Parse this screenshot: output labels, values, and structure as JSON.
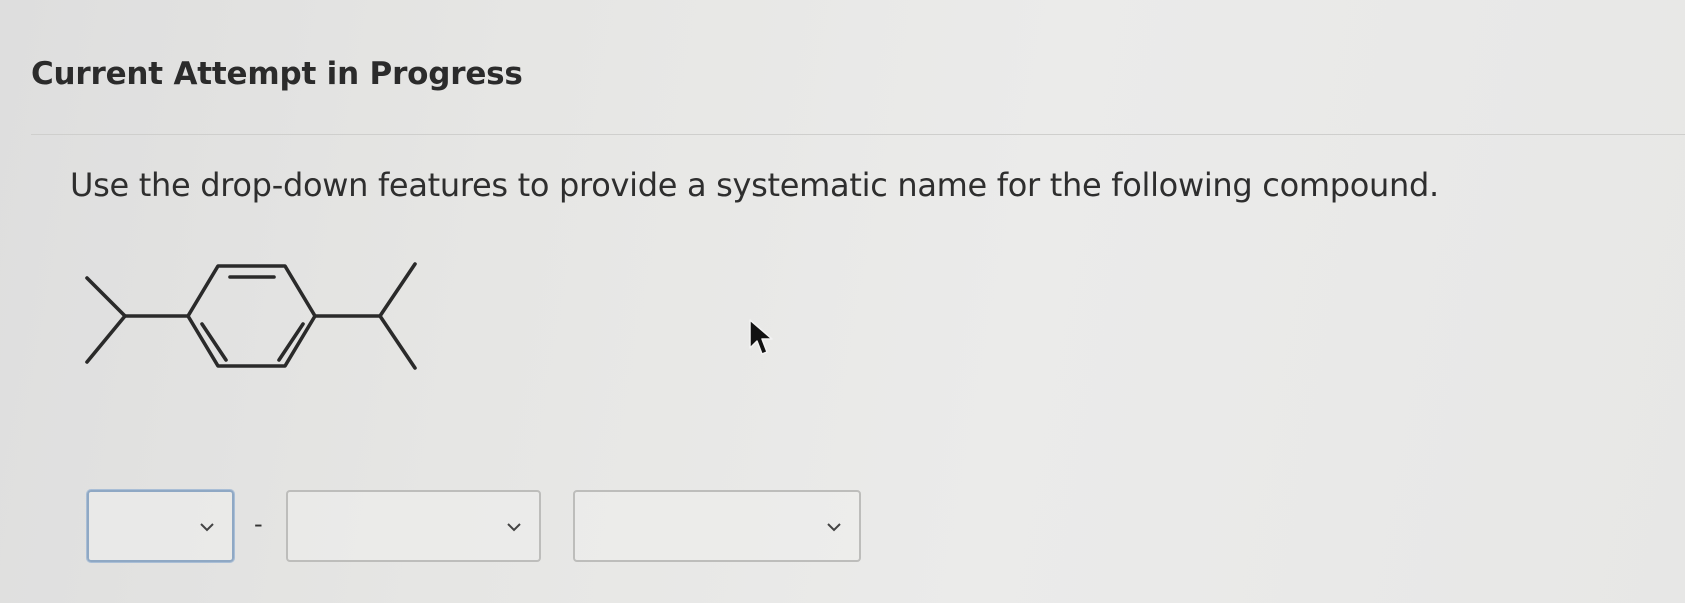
{
  "header": {
    "title": "Current Attempt in Progress"
  },
  "question": {
    "prompt": "Use the drop-down features to provide a systematic name for the following compound."
  },
  "answer": {
    "separator": "-",
    "dropdowns": [
      {
        "id": "locants",
        "value": ""
      },
      {
        "id": "substituent",
        "value": ""
      },
      {
        "id": "parent",
        "value": ""
      }
    ]
  },
  "icons": {
    "dropdown_chevron": "chevron-down-icon",
    "pointer": "mouse-cursor-icon"
  },
  "colors": {
    "focus_border": "#8fa8c4",
    "bond_line": "#2a2a2a"
  }
}
